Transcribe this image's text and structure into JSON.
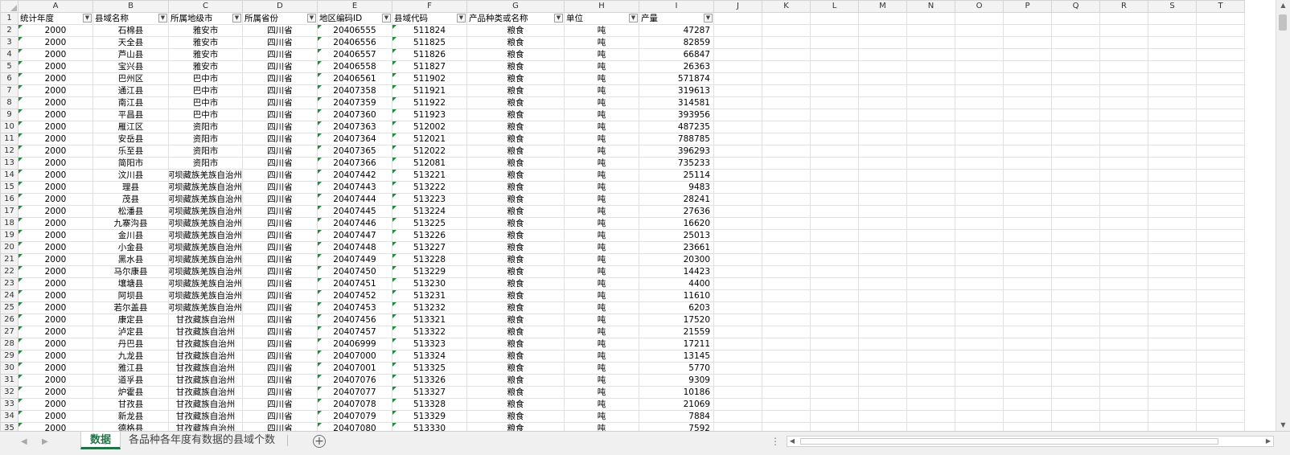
{
  "columns": [
    "A",
    "B",
    "C",
    "D",
    "E",
    "F",
    "G",
    "H",
    "I",
    "J",
    "K",
    "L",
    "M",
    "N",
    "O",
    "P",
    "Q",
    "R",
    "S",
    "T"
  ],
  "headers": [
    "统计年度",
    "县域名称",
    "所属地级市",
    "所属省份",
    "地区编码ID",
    "县域代码",
    "产品种类或名称",
    "单位",
    "产量"
  ],
  "rows": [
    {
      "n": "2",
      "year": "2000",
      "county": "石棉县",
      "city": "雅安市",
      "prov": "四川省",
      "id": "20406555",
      "code": "511824",
      "prod": "粮食",
      "unit": "吨",
      "qty": "47287"
    },
    {
      "n": "3",
      "year": "2000",
      "county": "天全县",
      "city": "雅安市",
      "prov": "四川省",
      "id": "20406556",
      "code": "511825",
      "prod": "粮食",
      "unit": "吨",
      "qty": "82859"
    },
    {
      "n": "4",
      "year": "2000",
      "county": "芦山县",
      "city": "雅安市",
      "prov": "四川省",
      "id": "20406557",
      "code": "511826",
      "prod": "粮食",
      "unit": "吨",
      "qty": "66847"
    },
    {
      "n": "5",
      "year": "2000",
      "county": "宝兴县",
      "city": "雅安市",
      "prov": "四川省",
      "id": "20406558",
      "code": "511827",
      "prod": "粮食",
      "unit": "吨",
      "qty": "26363"
    },
    {
      "n": "6",
      "year": "2000",
      "county": "巴州区",
      "city": "巴中市",
      "prov": "四川省",
      "id": "20406561",
      "code": "511902",
      "prod": "粮食",
      "unit": "吨",
      "qty": "571874"
    },
    {
      "n": "7",
      "year": "2000",
      "county": "通江县",
      "city": "巴中市",
      "prov": "四川省",
      "id": "20407358",
      "code": "511921",
      "prod": "粮食",
      "unit": "吨",
      "qty": "319613"
    },
    {
      "n": "8",
      "year": "2000",
      "county": "南江县",
      "city": "巴中市",
      "prov": "四川省",
      "id": "20407359",
      "code": "511922",
      "prod": "粮食",
      "unit": "吨",
      "qty": "314581"
    },
    {
      "n": "9",
      "year": "2000",
      "county": "平昌县",
      "city": "巴中市",
      "prov": "四川省",
      "id": "20407360",
      "code": "511923",
      "prod": "粮食",
      "unit": "吨",
      "qty": "393956"
    },
    {
      "n": "10",
      "year": "2000",
      "county": "雁江区",
      "city": "资阳市",
      "prov": "四川省",
      "id": "20407363",
      "code": "512002",
      "prod": "粮食",
      "unit": "吨",
      "qty": "487235"
    },
    {
      "n": "11",
      "year": "2000",
      "county": "安岳县",
      "city": "资阳市",
      "prov": "四川省",
      "id": "20407364",
      "code": "512021",
      "prod": "粮食",
      "unit": "吨",
      "qty": "788785"
    },
    {
      "n": "12",
      "year": "2000",
      "county": "乐至县",
      "city": "资阳市",
      "prov": "四川省",
      "id": "20407365",
      "code": "512022",
      "prod": "粮食",
      "unit": "吨",
      "qty": "396293"
    },
    {
      "n": "13",
      "year": "2000",
      "county": "简阳市",
      "city": "资阳市",
      "prov": "四川省",
      "id": "20407366",
      "code": "512081",
      "prod": "粮食",
      "unit": "吨",
      "qty": "735233"
    },
    {
      "n": "14",
      "year": "2000",
      "county": "汶川县",
      "city": "阿坝藏族羌族自治州",
      "prov": "四川省",
      "id": "20407442",
      "code": "513221",
      "prod": "粮食",
      "unit": "吨",
      "qty": "25114"
    },
    {
      "n": "15",
      "year": "2000",
      "county": "理县",
      "city": "阿坝藏族羌族自治州",
      "prov": "四川省",
      "id": "20407443",
      "code": "513222",
      "prod": "粮食",
      "unit": "吨",
      "qty": "9483"
    },
    {
      "n": "16",
      "year": "2000",
      "county": "茂县",
      "city": "阿坝藏族羌族自治州",
      "prov": "四川省",
      "id": "20407444",
      "code": "513223",
      "prod": "粮食",
      "unit": "吨",
      "qty": "28241"
    },
    {
      "n": "17",
      "year": "2000",
      "county": "松潘县",
      "city": "阿坝藏族羌族自治州",
      "prov": "四川省",
      "id": "20407445",
      "code": "513224",
      "prod": "粮食",
      "unit": "吨",
      "qty": "27636"
    },
    {
      "n": "18",
      "year": "2000",
      "county": "九寨沟县",
      "city": "阿坝藏族羌族自治州",
      "prov": "四川省",
      "id": "20407446",
      "code": "513225",
      "prod": "粮食",
      "unit": "吨",
      "qty": "16620"
    },
    {
      "n": "19",
      "year": "2000",
      "county": "金川县",
      "city": "阿坝藏族羌族自治州",
      "prov": "四川省",
      "id": "20407447",
      "code": "513226",
      "prod": "粮食",
      "unit": "吨",
      "qty": "25013"
    },
    {
      "n": "20",
      "year": "2000",
      "county": "小金县",
      "city": "阿坝藏族羌族自治州",
      "prov": "四川省",
      "id": "20407448",
      "code": "513227",
      "prod": "粮食",
      "unit": "吨",
      "qty": "23661"
    },
    {
      "n": "21",
      "year": "2000",
      "county": "黑水县",
      "city": "阿坝藏族羌族自治州",
      "prov": "四川省",
      "id": "20407449",
      "code": "513228",
      "prod": "粮食",
      "unit": "吨",
      "qty": "20300"
    },
    {
      "n": "22",
      "year": "2000",
      "county": "马尔康县",
      "city": "阿坝藏族羌族自治州",
      "prov": "四川省",
      "id": "20407450",
      "code": "513229",
      "prod": "粮食",
      "unit": "吨",
      "qty": "14423"
    },
    {
      "n": "23",
      "year": "2000",
      "county": "壤塘县",
      "city": "阿坝藏族羌族自治州",
      "prov": "四川省",
      "id": "20407451",
      "code": "513230",
      "prod": "粮食",
      "unit": "吨",
      "qty": "4400"
    },
    {
      "n": "24",
      "year": "2000",
      "county": "阿坝县",
      "city": "阿坝藏族羌族自治州",
      "prov": "四川省",
      "id": "20407452",
      "code": "513231",
      "prod": "粮食",
      "unit": "吨",
      "qty": "11610"
    },
    {
      "n": "25",
      "year": "2000",
      "county": "若尔盖县",
      "city": "阿坝藏族羌族自治州",
      "prov": "四川省",
      "id": "20407453",
      "code": "513232",
      "prod": "粮食",
      "unit": "吨",
      "qty": "6203"
    },
    {
      "n": "26",
      "year": "2000",
      "county": "康定县",
      "city": "甘孜藏族自治州",
      "prov": "四川省",
      "id": "20407456",
      "code": "513321",
      "prod": "粮食",
      "unit": "吨",
      "qty": "17520"
    },
    {
      "n": "27",
      "year": "2000",
      "county": "泸定县",
      "city": "甘孜藏族自治州",
      "prov": "四川省",
      "id": "20407457",
      "code": "513322",
      "prod": "粮食",
      "unit": "吨",
      "qty": "21559"
    },
    {
      "n": "28",
      "year": "2000",
      "county": "丹巴县",
      "city": "甘孜藏族自治州",
      "prov": "四川省",
      "id": "20406999",
      "code": "513323",
      "prod": "粮食",
      "unit": "吨",
      "qty": "17211"
    },
    {
      "n": "29",
      "year": "2000",
      "county": "九龙县",
      "city": "甘孜藏族自治州",
      "prov": "四川省",
      "id": "20407000",
      "code": "513324",
      "prod": "粮食",
      "unit": "吨",
      "qty": "13145"
    },
    {
      "n": "30",
      "year": "2000",
      "county": "雅江县",
      "city": "甘孜藏族自治州",
      "prov": "四川省",
      "id": "20407001",
      "code": "513325",
      "prod": "粮食",
      "unit": "吨",
      "qty": "5770"
    },
    {
      "n": "31",
      "year": "2000",
      "county": "道孚县",
      "city": "甘孜藏族自治州",
      "prov": "四川省",
      "id": "20407076",
      "code": "513326",
      "prod": "粮食",
      "unit": "吨",
      "qty": "9309"
    },
    {
      "n": "32",
      "year": "2000",
      "county": "炉霍县",
      "city": "甘孜藏族自治州",
      "prov": "四川省",
      "id": "20407077",
      "code": "513327",
      "prod": "粮食",
      "unit": "吨",
      "qty": "10186"
    },
    {
      "n": "33",
      "year": "2000",
      "county": "甘孜县",
      "city": "甘孜藏族自治州",
      "prov": "四川省",
      "id": "20407078",
      "code": "513328",
      "prod": "粮食",
      "unit": "吨",
      "qty": "21069"
    },
    {
      "n": "34",
      "year": "2000",
      "county": "新龙县",
      "city": "甘孜藏族自治州",
      "prov": "四川省",
      "id": "20407079",
      "code": "513329",
      "prod": "粮食",
      "unit": "吨",
      "qty": "7884"
    },
    {
      "n": "35",
      "year": "2000",
      "county": "德格县",
      "city": "甘孜藏族自治州",
      "prov": "四川省",
      "id": "20407080",
      "code": "513330",
      "prod": "粮食",
      "unit": "吨",
      "qty": "7592"
    }
  ],
  "sheets": {
    "active": "数据",
    "second": "各品种各年度有数据的县域个数"
  },
  "icons": {
    "add": "+",
    "nav_left": "◀",
    "nav_right": "▶",
    "more": "⋮"
  },
  "colors": {
    "accent": "#217346",
    "text_triangle": "#1f8a3a"
  }
}
